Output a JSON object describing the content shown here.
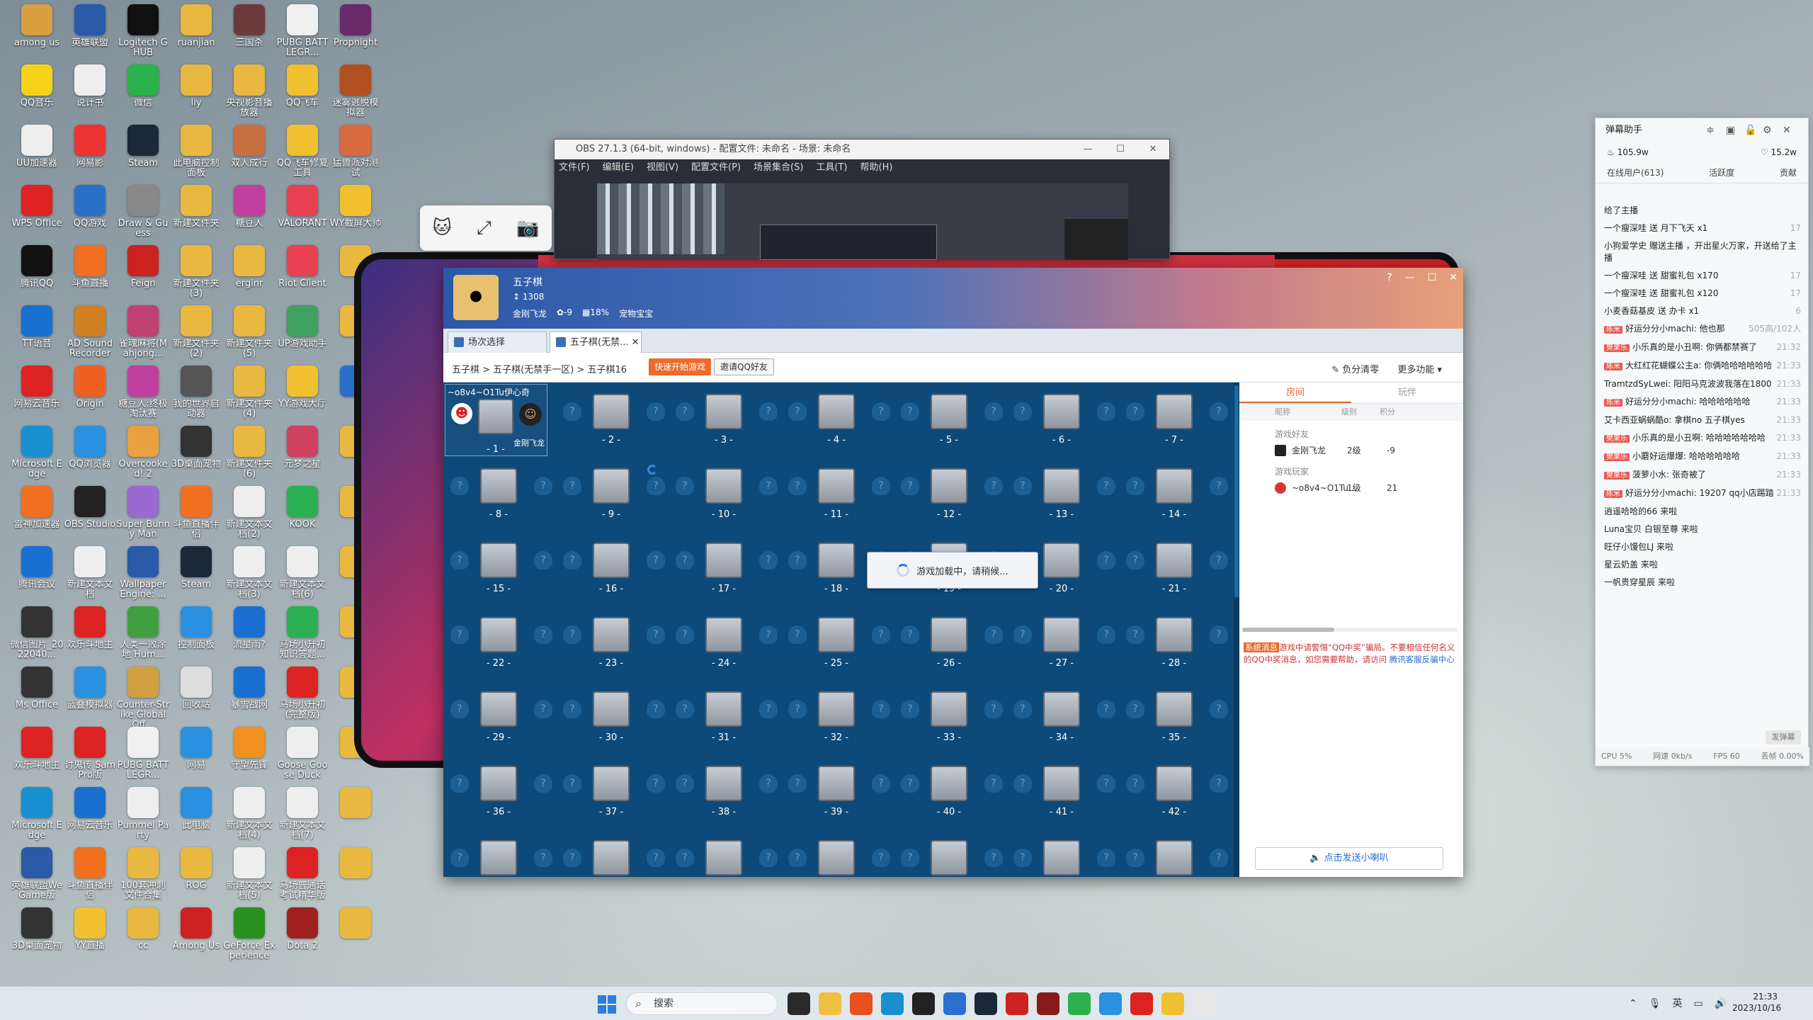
{
  "desktop_icons": [
    {
      "label": "among us",
      "color": "#d8a040"
    },
    {
      "label": "英雄联盟",
      "color": "#2a5aa8"
    },
    {
      "label": "Logitech G HUB",
      "color": "#111"
    },
    {
      "label": "ruanjian",
      "color": "#e8b840"
    },
    {
      "label": "三国杀",
      "color": "#6a3a3a"
    },
    {
      "label": "PUBG BATTLEGR...",
      "color": "#f0f0f0"
    },
    {
      "label": "Propnight",
      "color": "#6a2a6a"
    },
    {
      "label": "QQ音乐",
      "color": "#f7d21a"
    },
    {
      "label": "说计书",
      "color": "#eee"
    },
    {
      "label": "微信",
      "color": "#2bb24c"
    },
    {
      "label": "liy",
      "color": "#e8b840"
    },
    {
      "label": "央视影音播放器",
      "color": "#e8b840"
    },
    {
      "label": "QQ飞车",
      "color": "#f0c030"
    },
    {
      "label": "迷雾逃脱模拟器",
      "color": "#b05020"
    },
    {
      "label": "UU加速器",
      "color": "#eee"
    },
    {
      "label": "网易影",
      "color": "#e33"
    },
    {
      "label": "Steam",
      "color": "#1b2838"
    },
    {
      "label": "此电脑控制面板",
      "color": "#e8b840"
    },
    {
      "label": "双人成行",
      "color": "#c87040"
    },
    {
      "label": "QQ飞车修复工具",
      "color": "#f0c030"
    },
    {
      "label": "猛兽派对测试",
      "color": "#d86a40"
    },
    {
      "label": "WPS Office",
      "color": "#d22"
    },
    {
      "label": "QQ游戏",
      "color": "#2a70c8"
    },
    {
      "label": "Draw & Guess",
      "color": "#888"
    },
    {
      "label": "新建文件夹",
      "color": "#e8b840"
    },
    {
      "label": "糖豆人",
      "color": "#c040a0"
    },
    {
      "label": "VALORANT",
      "color": "#e84050"
    },
    {
      "label": "WY截屏大师",
      "color": "#f0c030"
    },
    {
      "label": "腾讯QQ",
      "color": "#111"
    },
    {
      "label": "斗鱼直播",
      "color": "#f07020"
    },
    {
      "label": "Feign",
      "color": "#c22"
    },
    {
      "label": "新建文件夹(3)",
      "color": "#e8b840"
    },
    {
      "label": "erginr",
      "color": "#e8b840"
    },
    {
      "label": "Riot Client",
      "color": "#e84050"
    },
    {
      "label": "",
      "color": "#e8b840"
    },
    {
      "label": "TT语音",
      "color": "#1a70d0"
    },
    {
      "label": "AD Sound Recorder",
      "color": "#d08020"
    },
    {
      "label": "雀魂麻将(Mahjong...",
      "color": "#c04070"
    },
    {
      "label": "新建文件夹(2)",
      "color": "#e8b840"
    },
    {
      "label": "新建文件夹(5)",
      "color": "#e8b840"
    },
    {
      "label": "UP游戏助手",
      "color": "#40a060"
    },
    {
      "label": "",
      "color": "#e8b840"
    },
    {
      "label": "网易云音乐",
      "color": "#d22"
    },
    {
      "label": "Origin",
      "color": "#f06020"
    },
    {
      "label": "糖豆人:终极淘汰赛",
      "color": "#c040a0"
    },
    {
      "label": "我的世界启动器",
      "color": "#555"
    },
    {
      "label": "新建文件夹(4)",
      "color": "#e8b840"
    },
    {
      "label": "YY游戏大厅",
      "color": "#f0c030"
    },
    {
      "label": "",
      "color": "#2a70c8"
    },
    {
      "label": "Microsoft Edge",
      "color": "#1a8fd0"
    },
    {
      "label": "QQ浏览器",
      "color": "#2a90e0"
    },
    {
      "label": "Overcooked! 2",
      "color": "#e8a040"
    },
    {
      "label": "3D桌面宠物",
      "color": "#333"
    },
    {
      "label": "新建文件夹(6)",
      "color": "#e8b840"
    },
    {
      "label": "元梦之星",
      "color": "#d04060"
    },
    {
      "label": "",
      "color": "#e8b840"
    },
    {
      "label": "雷神加速器",
      "color": "#f07020"
    },
    {
      "label": "OBS Studio",
      "color": "#222"
    },
    {
      "label": "Super Bunny Man",
      "color": "#9a6ad0"
    },
    {
      "label": "斗鱼直播伴侣",
      "color": "#f07020"
    },
    {
      "label": "新建文本文档(2)",
      "color": "#eee"
    },
    {
      "label": "KOOK",
      "color": "#2ab050"
    },
    {
      "label": "",
      "color": "#e8b840"
    },
    {
      "label": "腾讯会议",
      "color": "#1a70d0"
    },
    {
      "label": "新建文本文档",
      "color": "#eee"
    },
    {
      "label": "Wallpaper Engine: ...",
      "color": "#2a5aa8"
    },
    {
      "label": "Steam",
      "color": "#1b2838"
    },
    {
      "label": "新建文本文档(3)",
      "color": "#eee"
    },
    {
      "label": "新建文本文档(6)",
      "color": "#eee"
    },
    {
      "label": "",
      "color": "#e8b840"
    },
    {
      "label": "微信图片_2022040...",
      "color": "#333"
    },
    {
      "label": "欢乐斗地主",
      "color": "#d22"
    },
    {
      "label": "人类一败涂地 Hum...",
      "color": "#40a040"
    },
    {
      "label": "控制面板",
      "color": "#2a90e0"
    },
    {
      "label": "流星雨?",
      "color": "#1a70d0"
    },
    {
      "label": "马场小升初知识答题...",
      "color": "#2ab050"
    },
    {
      "label": "",
      "color": "#e8b840"
    },
    {
      "label": "Ms Office",
      "color": "#333"
    },
    {
      "label": "蓝叠模拟器",
      "color": "#2a90e0"
    },
    {
      "label": "Counter-Strike Global Off...",
      "color": "#d0a040"
    },
    {
      "label": "回收站",
      "color": "#ddd"
    },
    {
      "label": "暴雪战网",
      "color": "#1a70d0"
    },
    {
      "label": "马场小升初(完整版)",
      "color": "#d22"
    },
    {
      "label": "",
      "color": "#e8b840"
    },
    {
      "label": "欢乐斗地主",
      "color": "#d22"
    },
    {
      "label": "讨鬼传 SamPro版",
      "color": "#d22"
    },
    {
      "label": "PUBG BATTLEGR...",
      "color": "#f0f0f0"
    },
    {
      "label": "网易",
      "color": "#2a90e0"
    },
    {
      "label": "守望先锋",
      "color": "#f09020"
    },
    {
      "label": "Goose Goose Duck",
      "color": "#eee"
    },
    {
      "label": "",
      "color": "#e8b840"
    },
    {
      "label": "Microsoft Edge",
      "color": "#1a8fd0"
    },
    {
      "label": "网易云音乐",
      "color": "#1a70d0"
    },
    {
      "label": "Pummel Party",
      "color": "#eee"
    },
    {
      "label": "此电脑",
      "color": "#2a90e0"
    },
    {
      "label": "新建文本文档(4)",
      "color": "#eee"
    },
    {
      "label": "新建文本文档(7)",
      "color": "#eee"
    },
    {
      "label": "",
      "color": "#e8b840"
    },
    {
      "label": "英雄联盟WeGame版",
      "color": "#2a5aa8"
    },
    {
      "label": "斗鱼直播伴侣",
      "color": "#f07020"
    },
    {
      "label": "100套冲刺文件合集",
      "color": "#e8b840"
    },
    {
      "label": "ROG",
      "color": "#e8b840"
    },
    {
      "label": "新建文本文档(5)",
      "color": "#eee"
    },
    {
      "label": "马场普通话考试精华版",
      "color": "#d22"
    },
    {
      "label": "",
      "color": "#e8b840"
    },
    {
      "label": "3D桌面宠物",
      "color": "#333"
    },
    {
      "label": "YY直播",
      "color": "#f0c030"
    },
    {
      "label": "cc",
      "color": "#e8b840"
    },
    {
      "label": "Among Us",
      "color": "#c22"
    },
    {
      "label": "GeForce Experience",
      "color": "#2a9020"
    },
    {
      "label": "Dota 2",
      "color": "#a02020"
    },
    {
      "label": "",
      "color": "#e8b840"
    }
  ],
  "obs": {
    "title": "OBS 27.1.3 (64-bit, windows) - 配置文件: 未命名 - 场景: 未命名",
    "menu": [
      "文件(F)",
      "编辑(E)",
      "视图(V)",
      "配置文件(P)",
      "场景集合(S)",
      "工具(T)",
      "帮助(H)"
    ]
  },
  "game": {
    "app_name": "五子棋",
    "score": "1308",
    "player": "金刚飞龙",
    "stat_wins": "-9",
    "stat_rate": "18%",
    "treasure": "宠物宝宝",
    "tabs": [
      "场次选择",
      "五子棋(无禁..."
    ],
    "breadcrumb": "五子棋 > 五子棋(无禁手一区) > 五子棋16",
    "quick_start": "快速开始游戏",
    "invite": "邀请QQ好友",
    "clear_neg": "负分清零",
    "more": "更多功能",
    "table1_name": "~o8v4~O1Tu伊心奇",
    "table1_player2": "金刚飞龙",
    "loading_text": "游戏加载中，请稍候...",
    "side_tabs": [
      "房间",
      "玩伴"
    ],
    "side_cols": [
      "昵称",
      "级别",
      "积分"
    ],
    "group_friends": "游戏好友",
    "group_players": "游戏玩家",
    "players": [
      {
        "name": "金刚飞龙",
        "level": "2级",
        "score": "-9"
      },
      {
        "name": "~o8v4~O1Tu...",
        "level": "1级",
        "score": "21"
      }
    ],
    "notice_tag": "系统消息",
    "notice_text": "游戏中请警惕“QQ中奖”骗局。不要相信任何名义的QQ中奖消息，如您需要帮助，请访问",
    "notice_link": "腾讯客服反骗中心",
    "speaker": "点击发送小喇叭"
  },
  "danmu": {
    "title": "弹幕助手",
    "hot": "105.9w",
    "likes": "15.2w",
    "online": "在线用户(613)",
    "activity": "活跃度",
    "rank": "贡献",
    "messages": [
      {
        "text": "给了主播"
      },
      {
        "text": "一个瘦深哇 送 月下飞天 x1",
        "tail": "17"
      },
      {
        "text": "小狗爱学史 赠送主播 ，开出星火万家，开送给了主播"
      },
      {
        "text": "一个瘦深哇 送 甜蜜礼包 x170",
        "tail": "17"
      },
      {
        "text": "一个瘦深哇 送 甜蜜礼包 x120",
        "tail": "17"
      },
      {
        "text": "小麦香菇基皮 送 办卡 x1",
        "tail": "6"
      },
      {
        "text": "好运分分小machi: 他也那",
        "badge": "陈米",
        "time": "505高/102人"
      },
      {
        "text": "小乐真的是小丑啊: 你俩都禁赛了",
        "badge": "樊果乐",
        "time": "21:32"
      },
      {
        "text": "大红红花蝴蝶公主a: 你俩哈哈哈哈哈哈",
        "badge": "陈米",
        "time": "21:33"
      },
      {
        "text": "TramtzdSyLwei: 阳阳马克波波我落在1800",
        "time": "21:33"
      },
      {
        "text": "好运分分小machi: 哈哈哈哈哈哈",
        "badge": "陈米",
        "time": "21:33"
      },
      {
        "text": "艾卡西亚蜗蜗酷o: 拿棋no 五子棋yes",
        "time": "21:33"
      },
      {
        "text": "小乐真的是小丑啊: 哈哈哈哈哈哈哈",
        "badge": "樊果乐",
        "time": "21:33"
      },
      {
        "text": "小蘑好运爆爆: 哈哈哈哈哈哈",
        "badge": "樊果乐",
        "time": "21:33"
      },
      {
        "text": "菠萝小水: 张奇被了",
        "badge": "樊果乐",
        "time": "21:33"
      },
      {
        "text": "好运分分小machi: 19207 qq小店踢踏",
        "badge": "陈米",
        "time": "21:33"
      },
      {
        "text": "逍遥哈哈的66 来啦"
      },
      {
        "text": "Luna宝贝 白银至尊 来啦"
      },
      {
        "text": "旺仔小馒包LJ 来啦"
      },
      {
        "text": "星云奶盖 来啦"
      },
      {
        "text": "一帆贵穿星辰 来啦"
      }
    ],
    "send": "发弹幕",
    "cpu": "CPU 5%",
    "net": "网速 0kb/s",
    "fps": "FPS 60",
    "drop": "丢帧 0.00%"
  },
  "taskbar": {
    "search": "搜索",
    "ime": "英",
    "time": "21:33",
    "date": "2023/10/16"
  },
  "colors": {
    "lobby": "#0e4a79",
    "accent": "#ef6a2c",
    "link": "#2a6ec8"
  }
}
